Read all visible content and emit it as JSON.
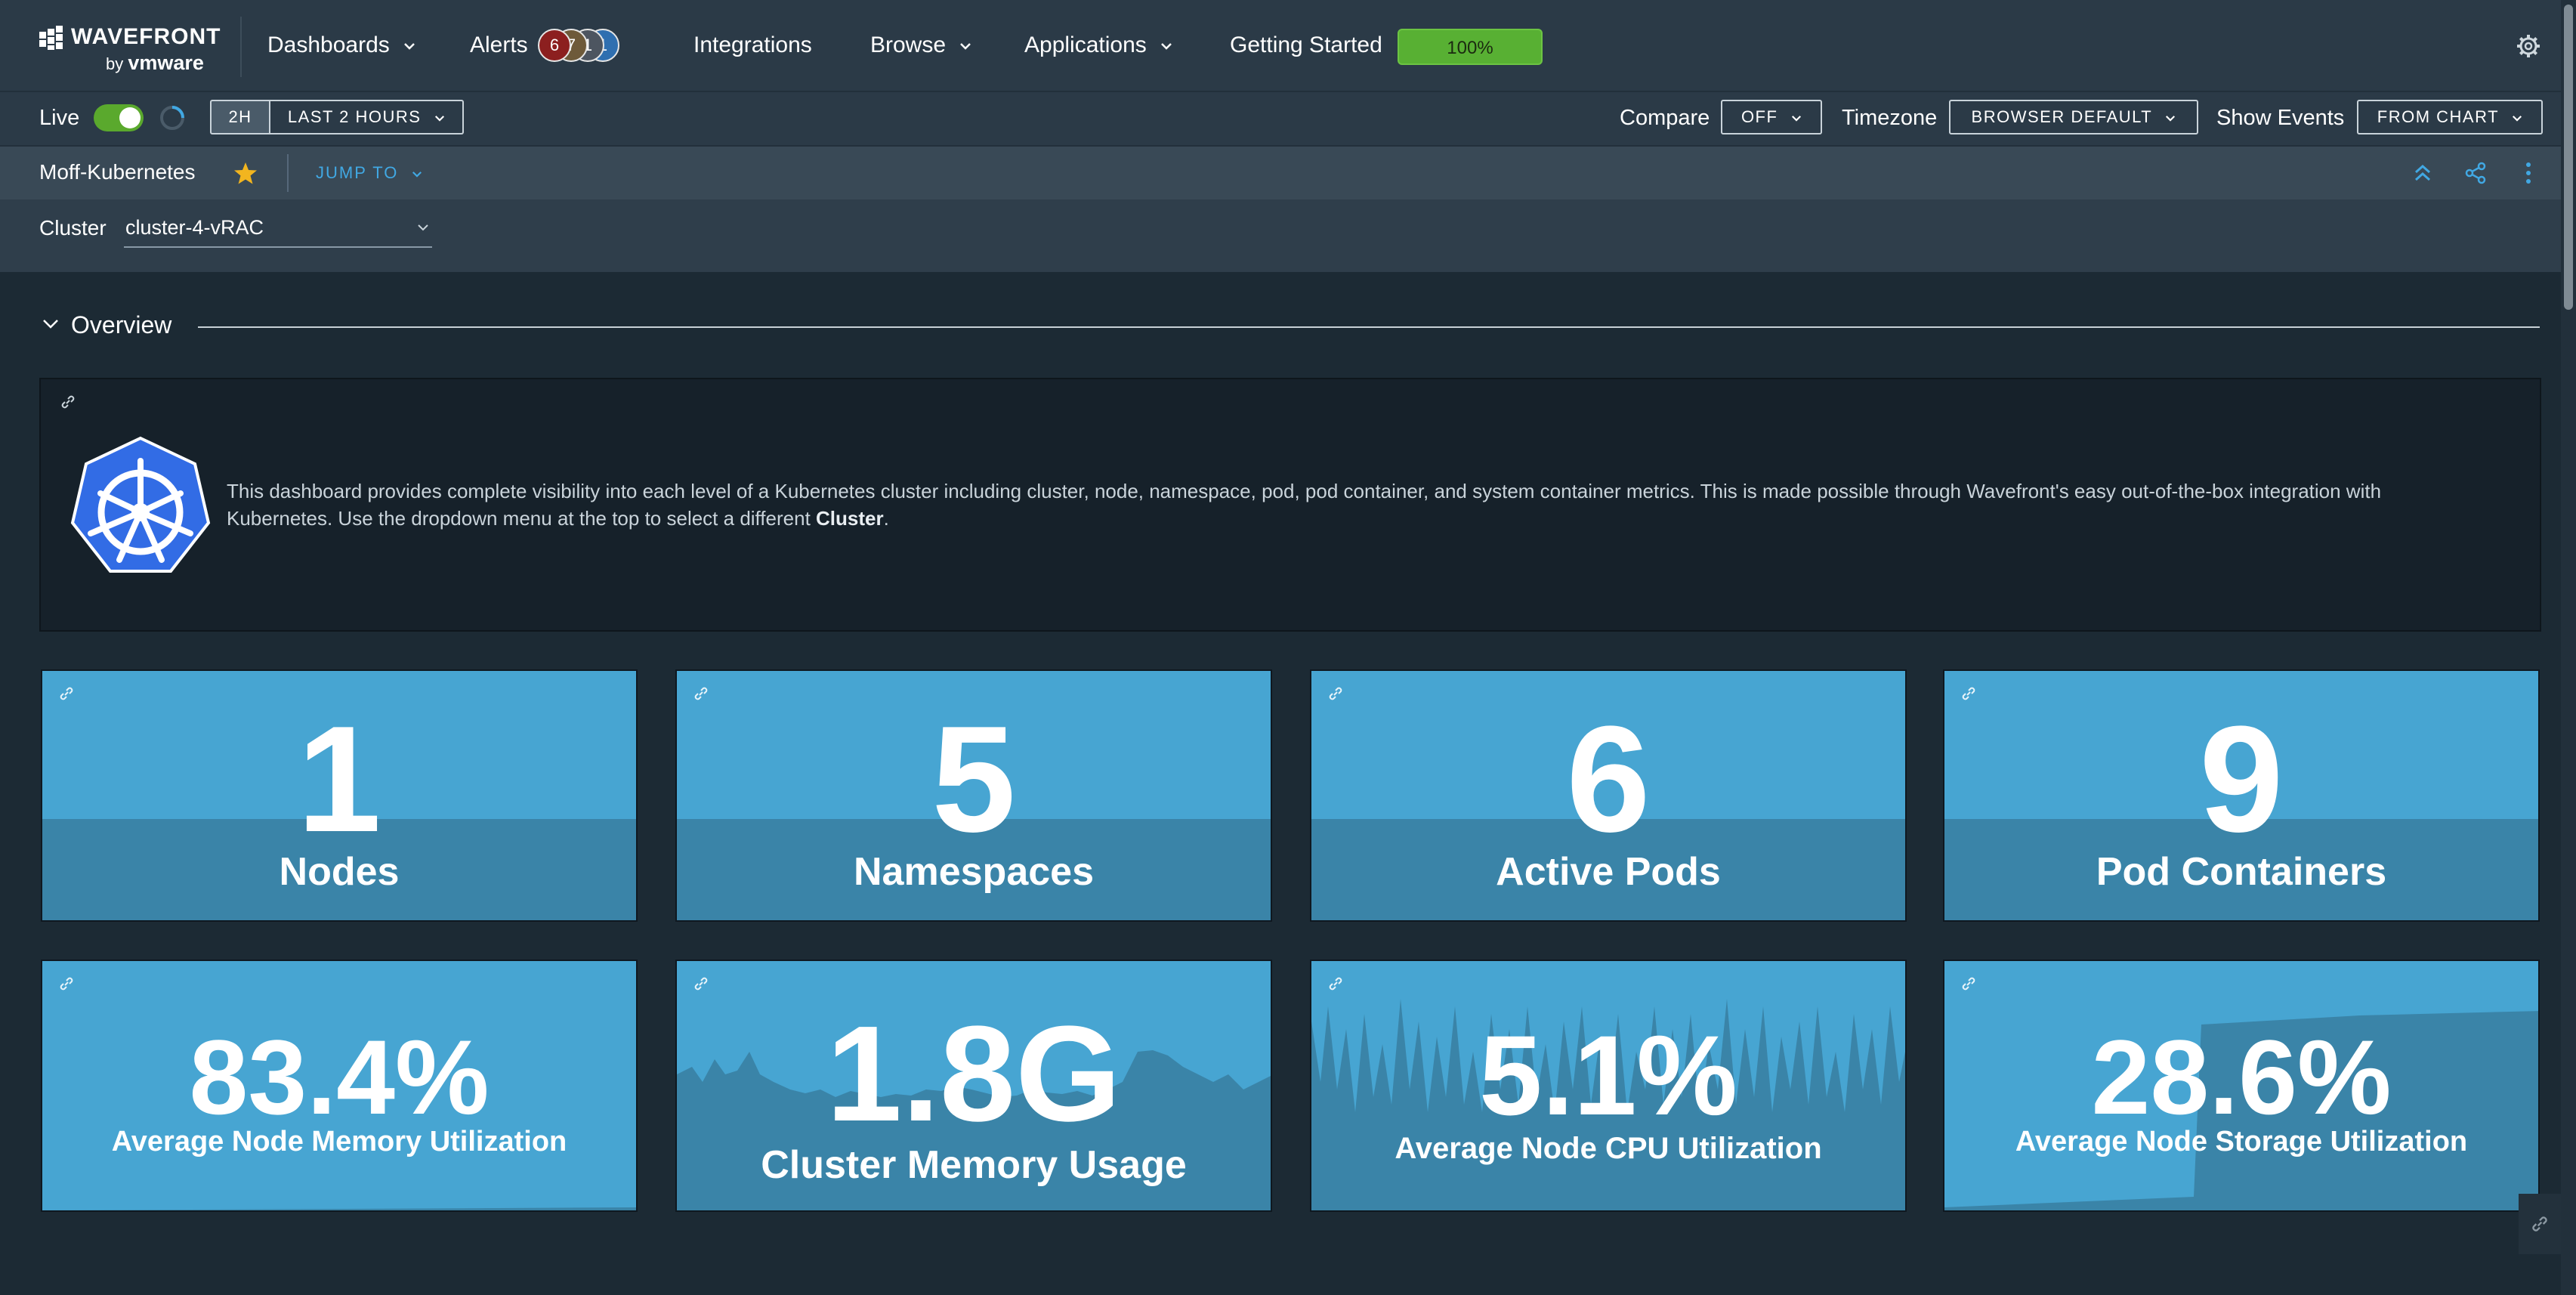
{
  "brand": {
    "name": "WAVEFRONT",
    "by": "by",
    "vendor": "vmware"
  },
  "nav": {
    "dashboards": "Dashboards",
    "alerts": "Alerts",
    "alert_counts": [
      "6",
      "7",
      "1",
      "1"
    ],
    "alert_colors": [
      "#8c1f1f",
      "#6e5a3a",
      "#4d5560",
      "#2f6fb0"
    ],
    "integrations": "Integrations",
    "browse": "Browse",
    "applications": "Applications",
    "getting_started": "Getting Started",
    "getting_started_progress": "100%"
  },
  "timebar": {
    "live": "Live",
    "live_on": true,
    "range_short": "2H",
    "range_long": "LAST 2 HOURS",
    "compare_label": "Compare",
    "compare_value": "OFF",
    "timezone_label": "Timezone",
    "timezone_value": "BROWSER DEFAULT",
    "events_label": "Show Events",
    "events_value": "FROM CHART"
  },
  "dashboard": {
    "title": "Moff-Kubernetes",
    "jump_to": "JUMP TO"
  },
  "variables": {
    "cluster_label": "Cluster",
    "cluster_value": "cluster-4-vRAC"
  },
  "section": {
    "title": "Overview"
  },
  "info": {
    "text_before": "This dashboard provides complete visibility into each level of a Kubernetes cluster including cluster, node, namespace, pod, pod container, and system container metrics. This is made possible through Wavefront's easy out-of-the-box integration with Kubernetes. Use the dropdown menu at the top to select a different ",
    "text_bold": "Cluster",
    "text_after": "."
  },
  "stats": [
    {
      "value": "1",
      "label": "Nodes"
    },
    {
      "value": "5",
      "label": "Namespaces"
    },
    {
      "value": "6",
      "label": "Active Pods"
    },
    {
      "value": "9",
      "label": "Pod Containers"
    }
  ],
  "metrics": [
    {
      "value": "83.4%",
      "label": "Average Node Memory Utilization"
    },
    {
      "value": "1.8G",
      "label": "Cluster Memory Usage"
    },
    {
      "value": "5.1%",
      "label": "Average Node CPU Utilization"
    },
    {
      "value": "28.6%",
      "label": "Average Node Storage Utilization"
    }
  ],
  "colors": {
    "accent_link": "#41a8e3",
    "tile_bg": "#47a5d2",
    "tile_band": "#3a84a8",
    "live_toggle": "#5aa92d",
    "progress": "#58b033",
    "star": "#f2b51f"
  },
  "icons": [
    "grid-logo-icon",
    "chevron-down-icon",
    "gear-icon",
    "spinner-icon",
    "star-icon",
    "collapse-up-icon",
    "share-icon",
    "more-vertical-icon",
    "link-icon",
    "kubernetes-logo-icon"
  ]
}
